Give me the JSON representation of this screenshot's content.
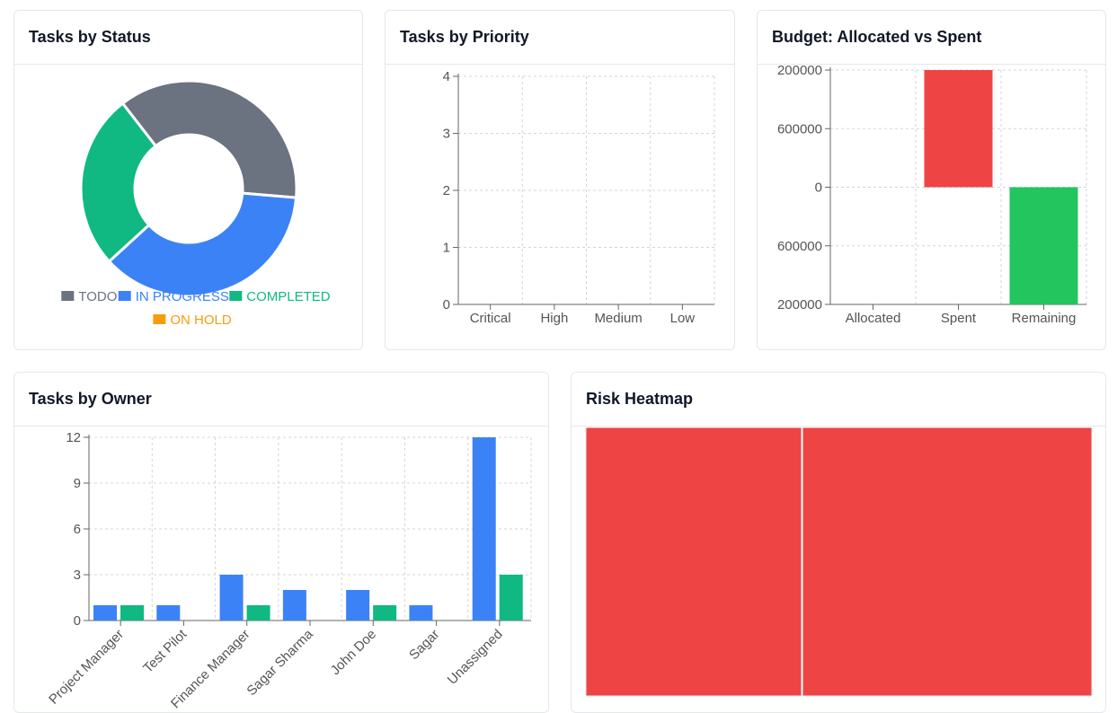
{
  "colors": {
    "todo": "#6b7280",
    "in_progress": "#3b82f6",
    "completed": "#10b981",
    "on_hold": "#f59e0b",
    "spent": "#ef4444",
    "remaining": "#22c55e",
    "heat": "#ef4444"
  },
  "cards": {
    "status_title": "Tasks by Status",
    "priority_title": "Tasks by Priority",
    "budget_title": "Budget: Allocated vs Spent",
    "owner_title": "Tasks by Owner",
    "risk_title": "Risk Heatmap"
  },
  "chart_data": [
    {
      "id": "status",
      "type": "pie",
      "labels": [
        "TODO",
        "IN PROGRESS",
        "COMPLETED",
        "ON HOLD"
      ],
      "values": [
        7,
        7,
        5,
        0
      ],
      "legend": "bottom"
    },
    {
      "id": "priority",
      "type": "bar",
      "categories": [
        "Critical",
        "High",
        "Medium",
        "Low"
      ],
      "values": [
        0,
        0,
        0,
        0
      ],
      "ylim": [
        0,
        4
      ],
      "yticks": [
        "0",
        "1",
        "2",
        "3",
        "4"
      ],
      "grid": true
    },
    {
      "id": "budget",
      "type": "bar",
      "categories": [
        "Allocated",
        "Spent",
        "Remaining"
      ],
      "values": [
        0,
        1200000,
        -1200000
      ],
      "ylim": [
        -1200000,
        1200000
      ],
      "yticks": [
        "200000",
        "600000",
        "0",
        "600000",
        "200000"
      ],
      "grid": true
    },
    {
      "id": "owner",
      "type": "bar",
      "categories": [
        "Project Manager",
        "Test Pilot",
        "Finance Manager",
        "Sagar Sharma",
        "John Doe",
        "Sagar",
        "Unassigned"
      ],
      "series": [
        {
          "values": [
            1,
            1,
            3,
            2,
            2,
            1,
            12
          ]
        },
        {
          "values": [
            1,
            0,
            1,
            0,
            1,
            0,
            3
          ]
        }
      ],
      "ylim": [
        0,
        12
      ],
      "yticks": [
        "0",
        "3",
        "6",
        "9",
        "12"
      ],
      "grid": true
    },
    {
      "id": "risk",
      "type": "heatmap",
      "cells": 2
    }
  ]
}
